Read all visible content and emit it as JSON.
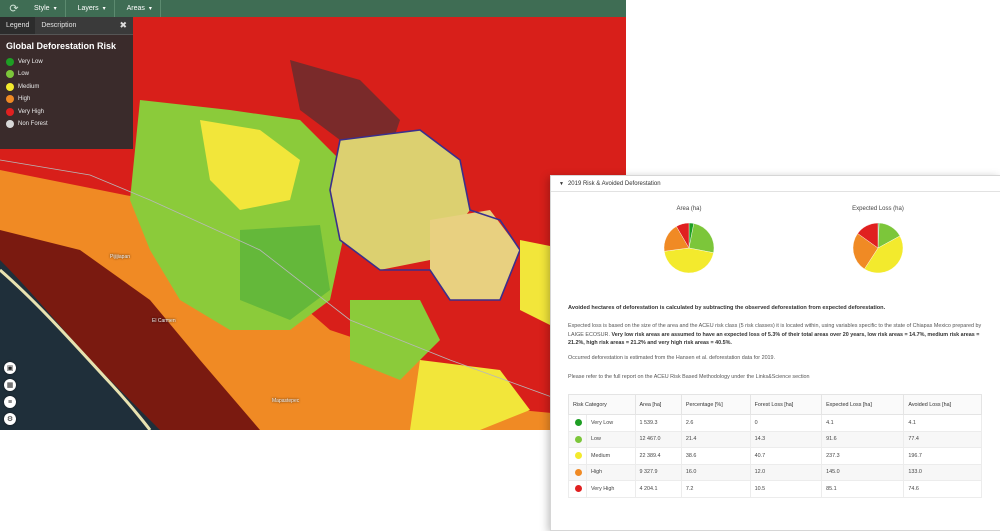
{
  "toolbar": {
    "logo_icon": "globe-leaf-icon",
    "menus": [
      {
        "label": "Style"
      },
      {
        "label": "Layers"
      },
      {
        "label": "Areas"
      }
    ]
  },
  "legend": {
    "tabs": [
      "Legend",
      "Description"
    ],
    "title": "Global Deforestation Risk",
    "items": [
      {
        "label": "Very Low",
        "color": "#1e9e24"
      },
      {
        "label": "Low",
        "color": "#7cc63a"
      },
      {
        "label": "Medium",
        "color": "#f3ea2d"
      },
      {
        "label": "High",
        "color": "#f08a24"
      },
      {
        "label": "Very High",
        "color": "#e02020"
      },
      {
        "label": "Non Forest",
        "color": "#d8d8d8"
      }
    ]
  },
  "map": {
    "places": [
      "Pijijiapan",
      "El Carmen",
      "Mapastepec"
    ]
  },
  "map_tools": [
    "save-icon",
    "calendar-icon",
    "list-icon",
    "settings-icon"
  ],
  "results": {
    "header": "2019 Risk & Avoided Deforestation",
    "pie_area_title": "Area (ha)",
    "pie_loss_title": "Expected Loss (ha)",
    "p_avoided": "Avoided hectares of deforestation is calculated by subtracting the observed deforestation from expected deforestation.",
    "p_expected_a": "Expected loss is based on the size of the area and the ACEU risk class (5 risk classes) it is located within, using variables specific to the state of Chiapas Mexico prepared by LAIGE ECOSUR.",
    "p_expected_b": "Very low risk areas are assumed to have an expected loss of 5.3% of their total areas over 20 years, low risk areas = 14.7%, medium risk areas = 21.2%, high risk areas = 21.2% and very high risk areas = 40.5%.",
    "p_occurred": "Occurred deforestation is estimated from the Hansen et al. deforestation data for 2019.",
    "p_refer": "Please refer to the full report on the ACEU Risk Based Methodology under the Links&Science section",
    "columns": [
      "Risk Category",
      "Area [ha]",
      "Percentage [%]",
      "Forest Loss [ha]",
      "Expected Loss [ha]",
      "Avoided Loss [ha]"
    ],
    "rows": [
      {
        "category": "Very Low",
        "color": "#1e9e24",
        "area": "1 539.3",
        "pct": "2.6",
        "forest_loss": "0",
        "expected": "4.1",
        "avoided": "4.1"
      },
      {
        "category": "Low",
        "color": "#7cc63a",
        "area": "12 467.0",
        "pct": "21.4",
        "forest_loss": "14.3",
        "expected": "91.6",
        "avoided": "77.4"
      },
      {
        "category": "Medium",
        "color": "#f3ea2d",
        "area": "22 389.4",
        "pct": "38.6",
        "forest_loss": "40.7",
        "expected": "237.3",
        "avoided": "196.7"
      },
      {
        "category": "High",
        "color": "#f08a24",
        "area": "9 327.9",
        "pct": "16.0",
        "forest_loss": "12.0",
        "expected": "145.0",
        "avoided": "133.0"
      },
      {
        "category": "Very High",
        "color": "#e02020",
        "area": "4 204.1",
        "pct": "7.2",
        "forest_loss": "10.5",
        "expected": "85.1",
        "avoided": "74.6"
      }
    ]
  },
  "chart_data": [
    {
      "type": "pie",
      "title": "Area (ha)",
      "labels": [
        "Very Low",
        "Low",
        "Medium",
        "High",
        "Very High"
      ],
      "values": [
        1539.3,
        12467.0,
        22389.4,
        9327.9,
        4204.1
      ],
      "colors": [
        "#1e9e24",
        "#7cc63a",
        "#f3ea2d",
        "#f08a24",
        "#e02020"
      ]
    },
    {
      "type": "pie",
      "title": "Expected Loss (ha)",
      "labels": [
        "Very Low",
        "Low",
        "Medium",
        "High",
        "Very High"
      ],
      "values": [
        4.1,
        91.6,
        237.3,
        145.0,
        85.1
      ],
      "colors": [
        "#1e9e24",
        "#7cc63a",
        "#f3ea2d",
        "#f08a24",
        "#e02020"
      ]
    }
  ]
}
